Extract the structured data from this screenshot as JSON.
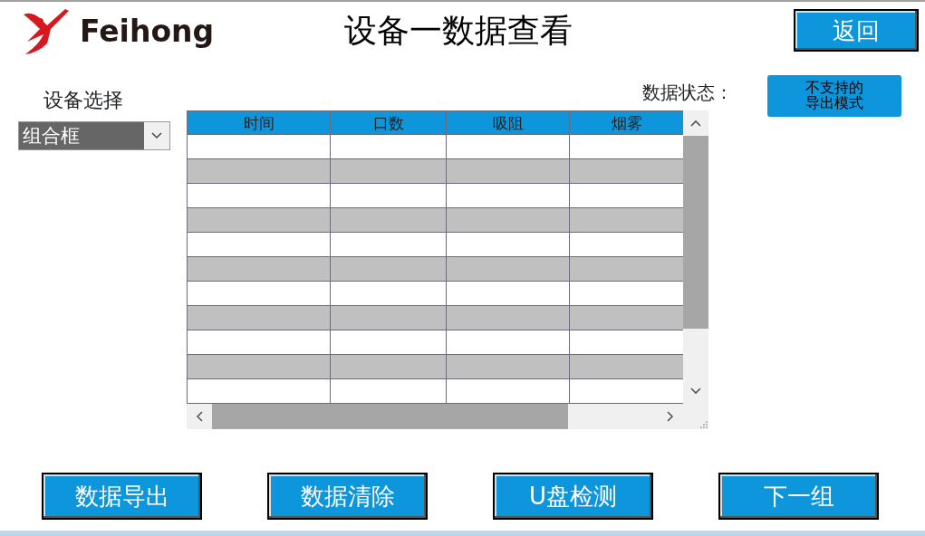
{
  "header": {
    "brand": "Feihong",
    "title": "设备一数据查看",
    "back_button": "返回"
  },
  "device_select": {
    "label": "设备选择",
    "value": "组合框"
  },
  "data_status": {
    "label": "数据状态：",
    "value": "不支持的导出模式"
  },
  "table": {
    "columns": [
      "时间",
      "口数",
      "吸阻",
      "烟雾"
    ],
    "rows": [
      {
        "shaded": false
      },
      {
        "shaded": true
      },
      {
        "shaded": false
      },
      {
        "shaded": true
      },
      {
        "shaded": false
      },
      {
        "shaded": true
      },
      {
        "shaded": false
      },
      {
        "shaded": true
      },
      {
        "shaded": false
      },
      {
        "shaded": true
      },
      {
        "shaded": false
      }
    ]
  },
  "buttons": [
    "数据导出",
    "数据清除",
    "U盘检测",
    "下一组"
  ]
}
